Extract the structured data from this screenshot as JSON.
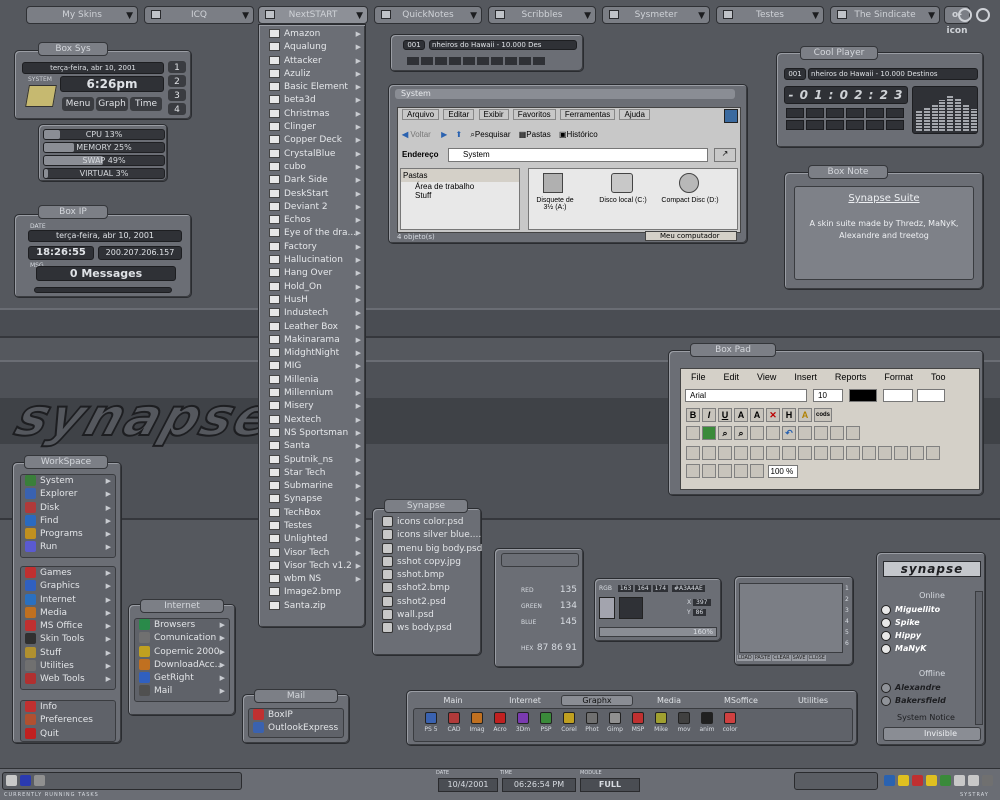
{
  "topbar": {
    "items": [
      "My Skins",
      "ICQ",
      "NextSTART",
      "QuickNotes",
      "Scribbles",
      "Sysmeter",
      "Testes",
      "The Sindicate"
    ],
    "right_icons": [
      "o-icon",
      "o-icon"
    ]
  },
  "box_sys": {
    "title": "Box Sys",
    "date": "terça-feira, abr 10, 2001",
    "label": "SYSTEM",
    "time": "6:26pm",
    "buttons": [
      "Menu",
      "Graph",
      "Time"
    ],
    "side": [
      "1",
      "2",
      "3",
      "4"
    ],
    "stats": [
      {
        "label": "CPU 13%",
        "v": 0.13
      },
      {
        "label": "MEMORY 25%",
        "v": 0.25
      },
      {
        "label": "SWAP 49%",
        "v": 0.49
      },
      {
        "label": "VIRTUAL 3%",
        "v": 0.03
      }
    ]
  },
  "box_ip": {
    "title": "Box IP",
    "date_label": "DATE",
    "date": "terça-feira, abr 10, 2001",
    "time": "18:26:55",
    "ip": "200.207.206.157",
    "msg_label": "MSG",
    "messages": "0 Messages"
  },
  "nextstart": {
    "items": [
      "Amazon",
      "Aqualung",
      "Attacker",
      "Azuliz",
      "Basic Element",
      "beta3d",
      "Christmas",
      "Clinger",
      "Copper Deck",
      "CrystalBlue",
      "cubo",
      "Dark Side",
      "DeskStart",
      "Deviant 2",
      "Echos",
      "Eye of the dra...",
      "Factory",
      "Hallucination",
      "Hang Over",
      "Hold_On",
      "HusH",
      "Industech",
      "Leather Box",
      "Makinarama",
      "MidghtNight",
      "MIG",
      "Millenia",
      "Millennium",
      "Misery",
      "Nextech",
      "NS Sportsman",
      "Santa",
      "Sputnik_ns",
      "Star Tech",
      "Submarine",
      "Synapse",
      "TechBox",
      "Testes",
      "Unlighted",
      "Visor Tech",
      "Visor Tech v1.2",
      "wbm NS",
      "Image2.bmp",
      "Santa.zip"
    ]
  },
  "media_small": {
    "track": "001",
    "title": "nheiros do Hawaii - 10.000 Des"
  },
  "explorer": {
    "title": "System",
    "menus": [
      "Arquivo",
      "Editar",
      "Exibir",
      "Favoritos",
      "Ferramentas",
      "Ajuda"
    ],
    "toolbar": {
      "back": "Voltar",
      "search": "Pesquisar",
      "folders": "Pastas",
      "history": "Histórico"
    },
    "address_label": "Endereço",
    "address": "System",
    "panel_title": "Pastas",
    "tree": [
      "Área de trabalho",
      "Stuff"
    ],
    "drives": [
      {
        "name": "Disquete de 3½ (A:)",
        "icon": "floppy-drive-icon"
      },
      {
        "name": "Disco local (C:)",
        "icon": "hard-disk-icon"
      },
      {
        "name": "Compact Disc (D:)",
        "icon": "cd-drive-icon"
      }
    ],
    "status_left": "4 objeto(s)",
    "status_right": "Meu computador"
  },
  "cool_player": {
    "title": "Cool Player",
    "track": "001",
    "song": "nheiros do Hawaii - 10.000 Destinos",
    "time": "- 0 1 : 0 2 : 2 3",
    "levels": [
      0.45,
      0.55,
      0.62,
      0.7,
      0.8,
      0.72,
      0.6,
      0.5
    ]
  },
  "box_note": {
    "title": "Box Note",
    "heading": "Synapse Suite",
    "body": "A skin suite made by Thredz, MaNyK, Alexandre and treetog"
  },
  "logo": "synapse",
  "box_pad": {
    "title": "Box Pad",
    "menus": [
      "File",
      "Edit",
      "View",
      "Insert",
      "Reports",
      "Format",
      "Too"
    ],
    "font": "Arial",
    "size": "10",
    "zoom": "100 %",
    "row2": [
      "B",
      "I",
      "U",
      "A",
      "A",
      "H",
      "A",
      "cods"
    ]
  },
  "workspace": {
    "title": "WorkSpace",
    "g1": [
      {
        "l": "System",
        "c": "#3a7f3a"
      },
      {
        "l": "Explorer",
        "c": "#3a62b0"
      },
      {
        "l": "Disk",
        "c": "#b03a3a"
      },
      {
        "l": "Find",
        "c": "#2a6ac0"
      },
      {
        "l": "Programs",
        "c": "#c09020"
      },
      {
        "l": "Run",
        "c": "#5a5ad0"
      }
    ],
    "g2": [
      {
        "l": "Games",
        "c": "#c03030"
      },
      {
        "l": "Graphics",
        "c": "#3060c0"
      },
      {
        "l": "Internet",
        "c": "#2a70c0"
      },
      {
        "l": "Media",
        "c": "#c07020"
      },
      {
        "l": "MS Office",
        "c": "#c03030"
      },
      {
        "l": "Skin Tools",
        "c": "#303030"
      },
      {
        "l": "Stuff",
        "c": "#b09030"
      },
      {
        "l": "Utilities",
        "c": "#707070"
      },
      {
        "l": "Web Tools",
        "c": "#b03030"
      }
    ],
    "g3": [
      {
        "l": "Info",
        "c": "#c03030"
      },
      {
        "l": "Preferences",
        "c": "#b05030"
      },
      {
        "l": "Quit",
        "c": "#c02020"
      }
    ]
  },
  "internet": {
    "title": "Internet",
    "items": [
      {
        "l": "Browsers",
        "c": "#2a8a4a"
      },
      {
        "l": "Comunication",
        "c": "#707070"
      },
      {
        "l": "Copernic 2000",
        "c": "#c0a020"
      },
      {
        "l": "DownloadAcc...",
        "c": "#c07020"
      },
      {
        "l": "GetRight",
        "c": "#3060c0"
      },
      {
        "l": "Mail",
        "c": "#505050"
      }
    ]
  },
  "mail": {
    "title": "Mail",
    "items": [
      {
        "l": "BoxIP",
        "c": "#c03030"
      },
      {
        "l": "OutlookExpress",
        "c": "#3a62b0"
      }
    ]
  },
  "synapse_files": {
    "title": "Synapse",
    "files": [
      "icons color.psd",
      "icons silver blue....",
      "menu big body.psd",
      "sshot copy.jpg",
      "sshot.bmp",
      "sshot2.bmp",
      "sshot2.psd",
      "wall.psd",
      "ws body.psd"
    ]
  },
  "rgb": {
    "red_label": "RED",
    "red": "135",
    "green_label": "GREEN",
    "green": "134",
    "blue_label": "BLUE",
    "blue": "145",
    "hex_label": "HEX",
    "hex": "87 86 91"
  },
  "picker": {
    "mode": "RGB",
    "r": "163",
    "g": "164",
    "b": "174",
    "hex": "#A3A4AE",
    "x_label": "X",
    "x": "397",
    "y_label": "Y",
    "y": "86",
    "zoom": "160%"
  },
  "blank_panel": {
    "tabs": [
      "LOAD",
      "PASTE",
      "CLEAR",
      "SAVE",
      "CLOSE"
    ],
    "nums": [
      "1",
      "2",
      "3",
      "4",
      "5",
      "6"
    ]
  },
  "launcher": {
    "tabs": [
      "Main",
      "Internet",
      "Graphx",
      "Media",
      "MSoffice",
      "Utilities"
    ],
    "active": "Graphx",
    "icons": [
      {
        "l": "PS 5",
        "c": "#3a62b0"
      },
      {
        "l": "CAD",
        "c": "#b03a3a"
      },
      {
        "l": "Imag",
        "c": "#c07020"
      },
      {
        "l": "Acro",
        "c": "#c02020"
      },
      {
        "l": "3Dm",
        "c": "#7a3ab0"
      },
      {
        "l": "PSP",
        "c": "#3a8a3a"
      },
      {
        "l": "Corel",
        "c": "#c0a020"
      },
      {
        "l": "Phot",
        "c": "#707070"
      },
      {
        "l": "Gimp",
        "c": "#909090"
      },
      {
        "l": "MSP",
        "c": "#c03030"
      },
      {
        "l": "Mike",
        "c": "#a0a030"
      },
      {
        "l": "mov",
        "c": "#404040"
      },
      {
        "l": "anim",
        "c": "#202020"
      },
      {
        "l": "color",
        "c": "#d04040"
      }
    ]
  },
  "icq": {
    "logo": "synapse",
    "online": "Online",
    "offline": "Offline",
    "on": [
      "Miguellito",
      "Spike",
      "Hippy",
      "MaNyK"
    ],
    "off": [
      "Alexandre",
      "Bakersfield"
    ],
    "notice": "System Notice",
    "status": "Invisible"
  },
  "taskbar": {
    "caption": "CURRENTLY RUNNING TASKS",
    "date_label": "DATE",
    "date": "10/4/2001",
    "time_label": "TIME",
    "time": "06:26:54 PM",
    "module_label": "MODULE",
    "module": "FULL",
    "systray": "SYSTRAY"
  }
}
